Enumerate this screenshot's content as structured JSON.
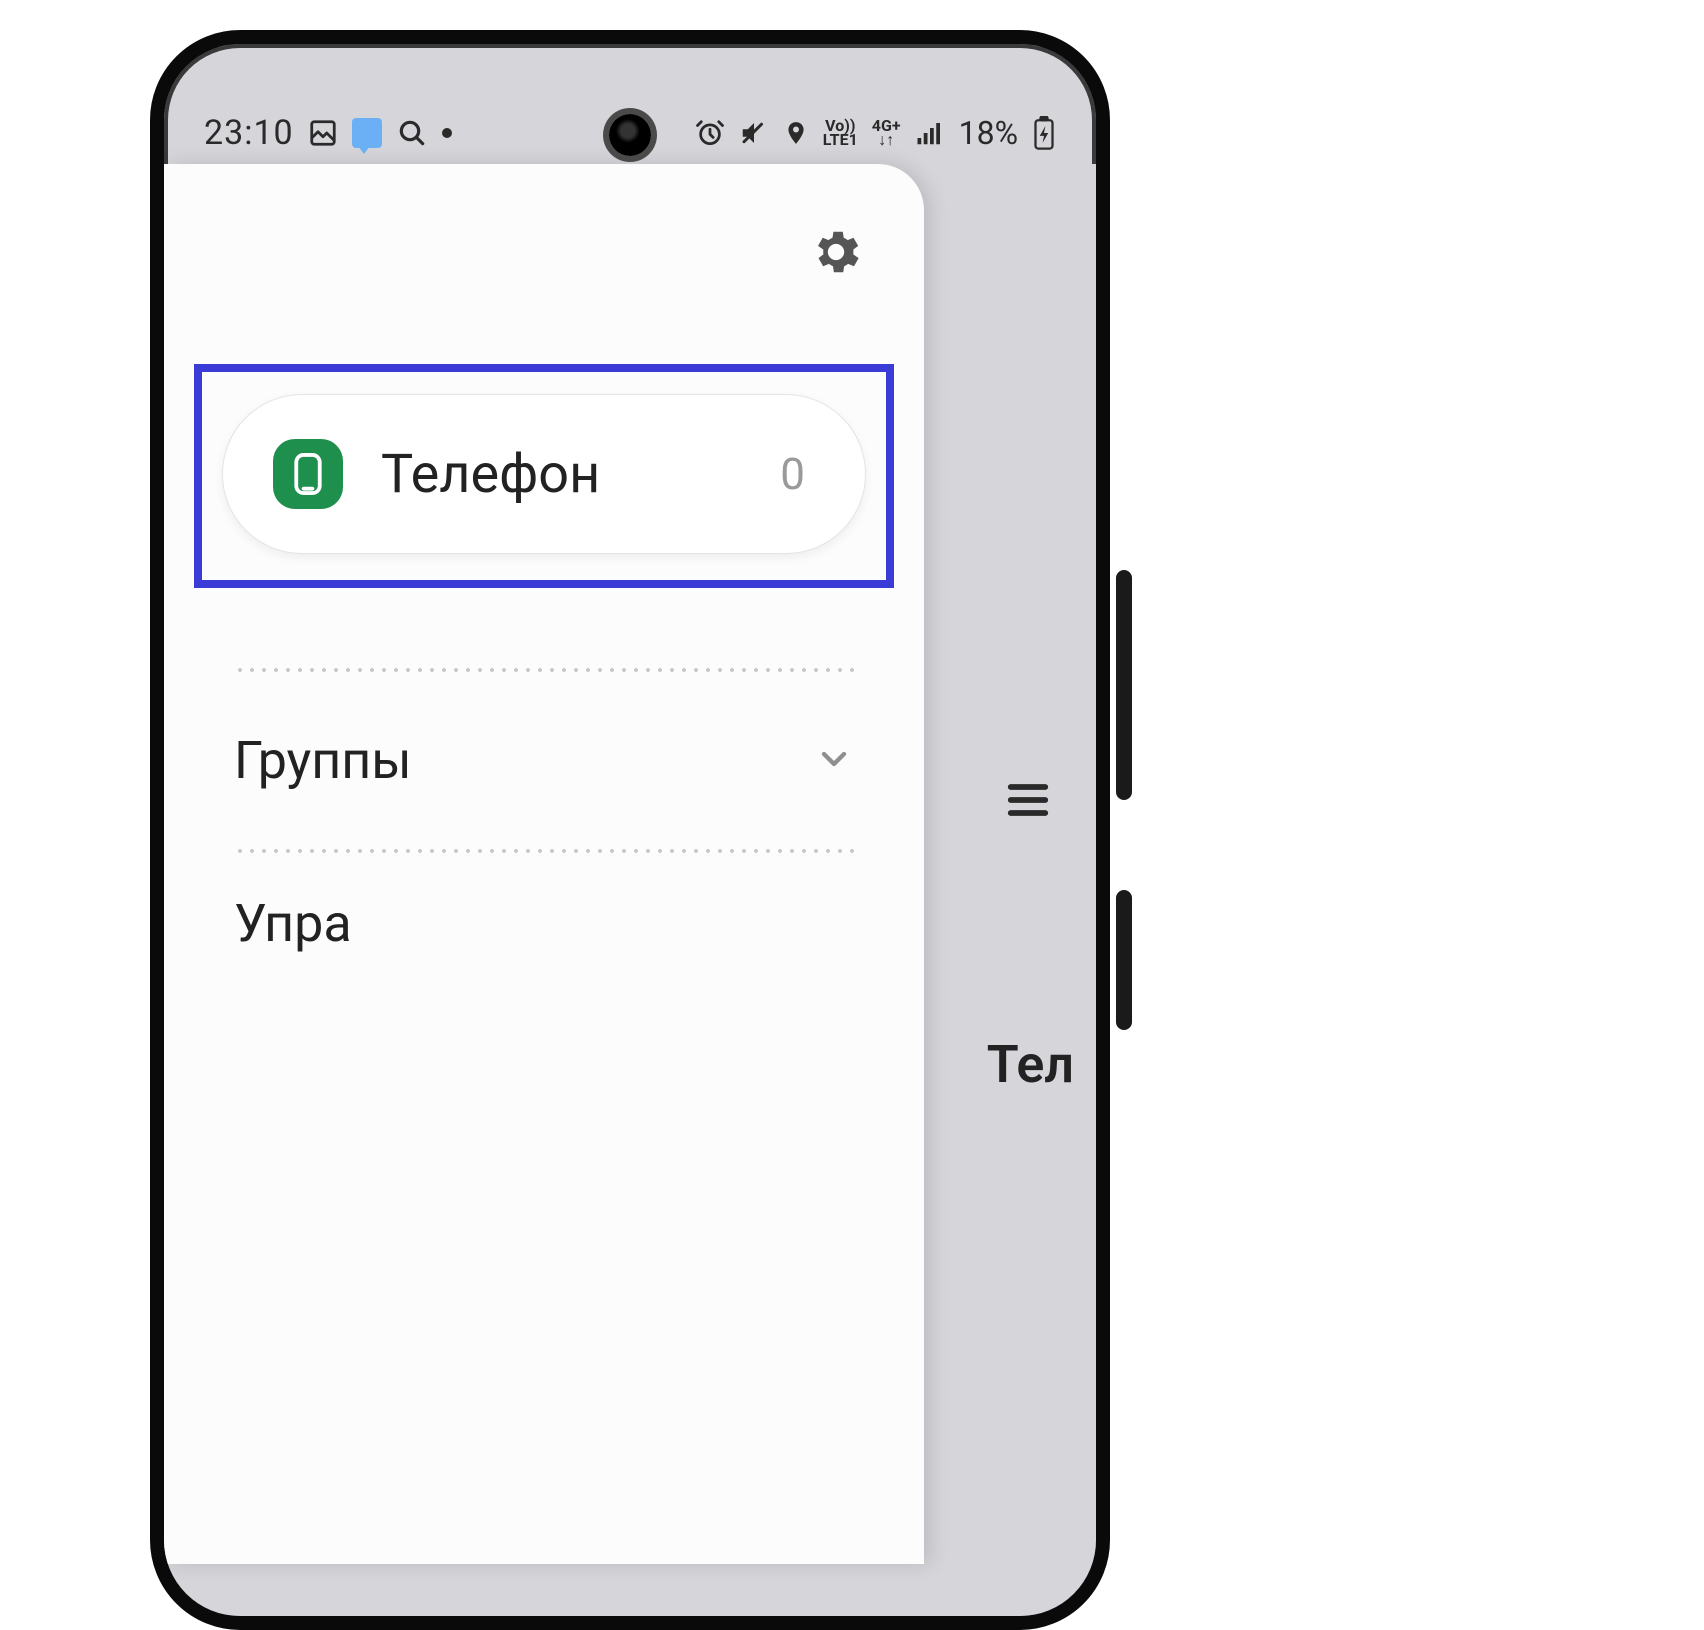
{
  "statusbar": {
    "time": "23:10",
    "battery_text": "18%",
    "network_top": "Vo))",
    "network_bot": "LTE1",
    "data_top": "4G+",
    "data_arrows": "↓↑"
  },
  "drawer": {
    "card": {
      "title": "Телефон",
      "count": "0"
    },
    "groups_label": "Группы",
    "manage_partial": "Упра"
  },
  "behind": {
    "peek_title": "Тел"
  }
}
